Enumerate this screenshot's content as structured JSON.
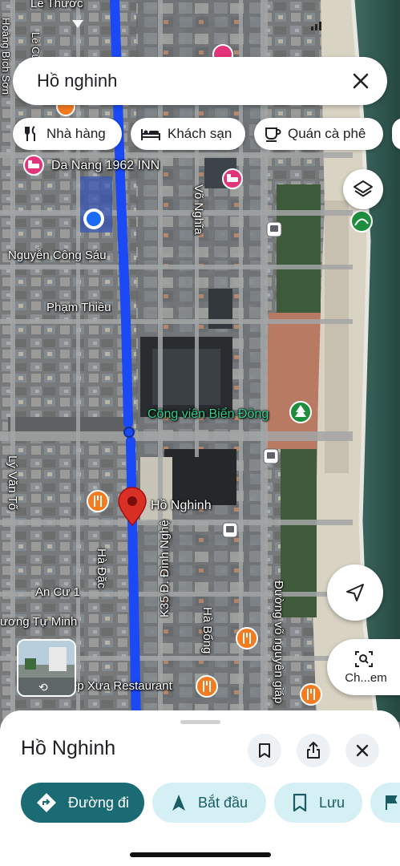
{
  "search": {
    "query": "Hồ nghinh"
  },
  "chips": [
    {
      "label": "Nhà hàng",
      "icon": "fork-knife-icon"
    },
    {
      "label": "Khách sạn",
      "icon": "bed-icon"
    },
    {
      "label": "Quán cà phê",
      "icon": "coffee-cup-icon"
    }
  ],
  "map": {
    "labels": {
      "le_thuoc": "Lê Thước",
      "hoang_bich_son": "Hoàng Bích Sơn",
      "le_cu": "Lê Cừ",
      "hotel": "Da Nang 1962 INN",
      "vo_nghia": "Võ Nghĩa",
      "nguyen_cong_sau": "Nguyễn Công Sáu",
      "pham_thieu": "Phạm Thiều",
      "park": "Công viên Biển Đông",
      "ly_van_to": "Lý Văn Tố",
      "ho_nghinh_pin": "Hồ Nghinh",
      "ha_dac": "Hà Đặc",
      "k35": "K35 Đ. Đình Nghệ",
      "an_cu": "An Cư 1",
      "luong_tu_minh": "ương Tự Minh",
      "ha_bong": "Hà Bổng",
      "vo_nguyen_giap": "Đường võ nguyên giáp",
      "restaurant": "ếp Xưa Restaurant"
    },
    "route_color": "#1a49f5",
    "pin_color": "#d93025"
  },
  "fabs": {
    "explore_label": "Ch...em"
  },
  "sheet": {
    "title": "Hồ Nghinh",
    "directions_label": "Đường đi",
    "start_label": "Bắt đầu",
    "save_label": "Lưu"
  }
}
